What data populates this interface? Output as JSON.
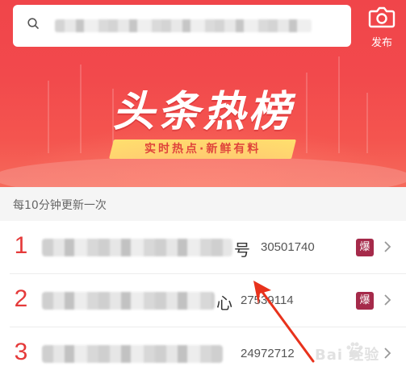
{
  "header": {
    "search": {
      "placeholder": ""
    },
    "publish_label": "发布",
    "banner_title": "头条热榜",
    "banner_slogan": "实时热点·新鲜有料"
  },
  "update_note": "每10分钟更新一次",
  "list": [
    {
      "rank": "1",
      "title_tail": "号",
      "hot_count": "30501740",
      "badge": "爆"
    },
    {
      "rank": "2",
      "title_tail": "心",
      "hot_count": "27539114",
      "badge": "爆"
    },
    {
      "rank": "3",
      "title_tail": "",
      "hot_count": "24972712",
      "badge": ""
    }
  ],
  "watermark": "Bai 经验",
  "colors": {
    "header_red": "#f0454a",
    "rank_red": "#e53a3a",
    "badge": "#a52a4a",
    "slogan_yellow": "#ffe66d",
    "arrow": "#e8321c"
  }
}
